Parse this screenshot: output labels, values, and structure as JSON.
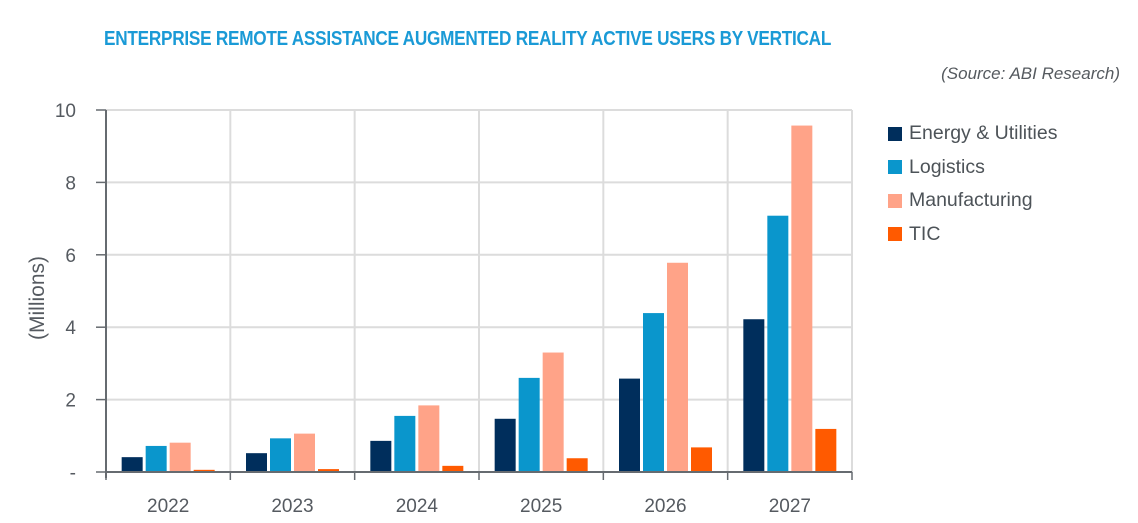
{
  "title": "ENTERPRISE REMOTE ASSISTANCE AUGMENTED REALITY ACTIVE USERS BY VERTICAL",
  "source": "(Source: ABI Research)",
  "chart_data": {
    "type": "bar",
    "title": "ENTERPRISE REMOTE ASSISTANCE AUGMENTED REALITY ACTIVE USERS BY VERTICAL",
    "subtitle": "(Source: ABI Research)",
    "xlabel": "",
    "ylabel": "(Millions)",
    "ylim": [
      0,
      10
    ],
    "yticks": [
      0,
      2,
      4,
      6,
      8,
      10
    ],
    "ytick_labels": [
      "-",
      "2",
      "4",
      "6",
      "8",
      "10"
    ],
    "grid": true,
    "legend_position": "right",
    "categories": [
      "2022",
      "2023",
      "2024",
      "2025",
      "2026",
      "2027"
    ],
    "series": [
      {
        "name": "Energy & Utilities",
        "color": "#002e5c",
        "values": [
          0.41,
          0.52,
          0.86,
          1.47,
          2.58,
          4.22
        ]
      },
      {
        "name": "Logistics",
        "color": "#0a96cc",
        "values": [
          0.72,
          0.93,
          1.55,
          2.6,
          4.39,
          7.08
        ]
      },
      {
        "name": "Manufacturing",
        "color": "#ffa388",
        "values": [
          0.81,
          1.06,
          1.84,
          3.3,
          5.78,
          9.57
        ]
      },
      {
        "name": "TIC",
        "color": "#ff5a00",
        "values": [
          0.06,
          0.08,
          0.17,
          0.38,
          0.68,
          1.19
        ]
      }
    ]
  }
}
